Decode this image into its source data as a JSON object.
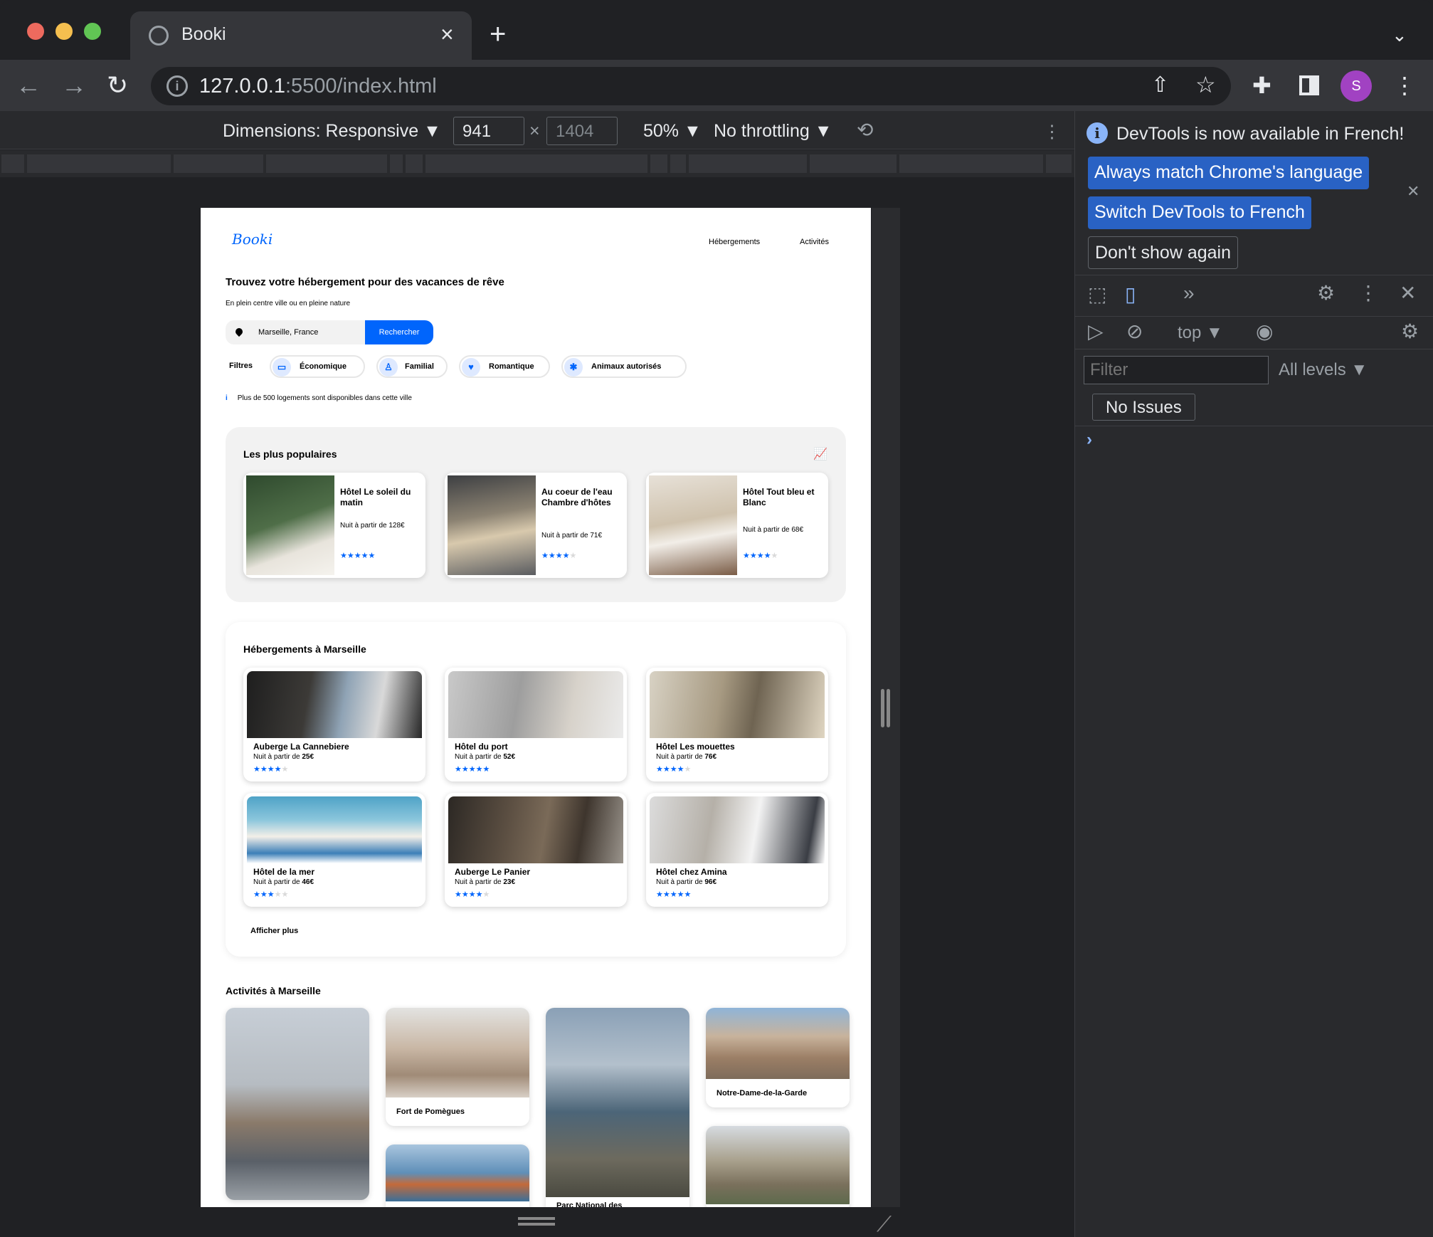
{
  "browser": {
    "tab_title": "Booki",
    "url_host": "127.0.0.1",
    "url_rest": ":5500/index.html",
    "avatar_letter": "S",
    "new_tab": "+",
    "tab_close": "×"
  },
  "device_toolbar": {
    "dimensions_label": "Dimensions: Responsive ▼",
    "width": "941",
    "times": "×",
    "height": "1404",
    "zoom": "50% ▼",
    "throttling": "No throttling ▼"
  },
  "site": {
    "logo": "Booki",
    "nav": [
      "Hébergements",
      "Activités"
    ],
    "headline": "Trouvez votre hébergement pour des vacances de rêve",
    "subline": "En plein centre ville ou en pleine nature",
    "search_value": "Marseille, France",
    "search_button": "Rechercher",
    "filters_label": "Filtres",
    "filters": [
      {
        "label": "Économique",
        "icon": "money-icon"
      },
      {
        "label": "Familial",
        "icon": "child-icon"
      },
      {
        "label": "Romantique",
        "icon": "heart-icon"
      },
      {
        "label": "Animaux autorisés",
        "icon": "dog-icon"
      }
    ],
    "info_text": "Plus de 500 logements sont disponibles dans cette ville",
    "popular": {
      "title": "Les plus populaires",
      "items": [
        {
          "name": "Hôtel Le soleil du matin",
          "price": "Nuit à partir de 128€",
          "rating": 5,
          "color": "#3f5a3a"
        },
        {
          "name": "Au coeur de l'eau Chambre d'hôtes",
          "price": "Nuit à partir de 71€",
          "rating": 4,
          "color": "#6b6658"
        },
        {
          "name": "Hôtel Tout bleu et Blanc",
          "price": "Nuit à partir de 68€",
          "rating": 4,
          "color": "#b9a890"
        }
      ]
    },
    "lodgings": {
      "title": "Hébergements à Marseille",
      "items": [
        {
          "name": "Auberge La Cannebiere",
          "price_prefix": "Nuit à partir de ",
          "price": "25€",
          "rating": 4,
          "color": "#3a3a3a"
        },
        {
          "name": "Hôtel du port",
          "price_prefix": "Nuit à partir de ",
          "price": "52€",
          "rating": 5,
          "color": "#a9a9a9"
        },
        {
          "name": "Hôtel Les mouettes",
          "price_prefix": "Nuit à partir de ",
          "price": "76€",
          "rating": 4,
          "color": "#8a8070"
        },
        {
          "name": "Hôtel de la mer",
          "price_prefix": "Nuit à partir de ",
          "price": "46€",
          "rating": 3,
          "color": "#7fb3c8"
        },
        {
          "name": "Auberge Le Panier",
          "price_prefix": "Nuit à partir de ",
          "price": "23€",
          "rating": 4,
          "color": "#4a4038"
        },
        {
          "name": "Hôtel chez Amina",
          "price_prefix": "Nuit à partir de ",
          "price": "96€",
          "rating": 5,
          "color": "#c9c9c9"
        }
      ],
      "more": "Afficher plus"
    },
    "activities": {
      "title": "Activités à Marseille",
      "items": [
        {
          "name": "",
          "color": "#8d96a0"
        },
        {
          "name": "Fort de Pomègues",
          "color": "#b8aca0"
        },
        {
          "name": "",
          "color": "#4f6b7d"
        },
        {
          "name": "Notre-Dame-de-la-Garde",
          "color": "#a08e7a"
        },
        {
          "name": "Parc National des",
          "color": "#6e7770"
        },
        {
          "name": "",
          "color": "#6f95b8"
        },
        {
          "name": "",
          "color": "#8a8270"
        }
      ]
    },
    "accent": "#0065fc"
  },
  "devtools": {
    "message": "DevTools is now available in French!",
    "btn_match": "Always match Chrome's language",
    "btn_switch": "Switch DevTools to French",
    "btn_dont": "Don't show again",
    "context": "top ▼",
    "filter_placeholder": "Filter",
    "levels": "All levels ▼",
    "issues": "No Issues",
    "prompt": "›"
  }
}
